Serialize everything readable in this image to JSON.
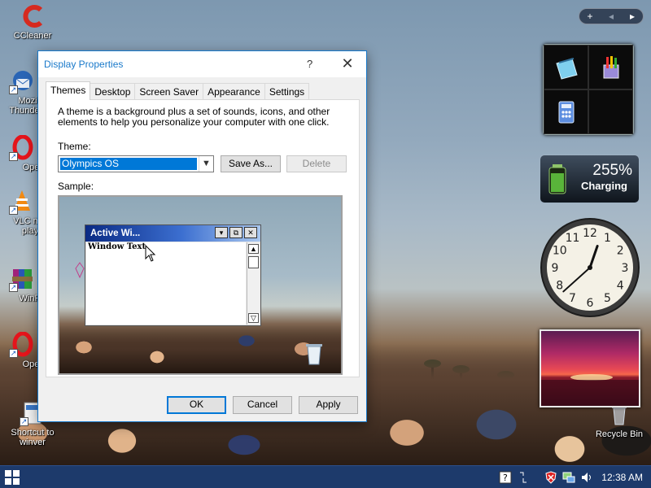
{
  "desktop": {
    "icons": [
      {
        "label": "CCleaner"
      },
      {
        "label": "Mozilla Thunderbird",
        "line1": "Mozi",
        "line2": "Thunde"
      },
      {
        "label": "Ope"
      },
      {
        "label": "VLC media player",
        "line1": "VLC m",
        "line2": "play"
      },
      {
        "label": "WinR"
      },
      {
        "label": "Ope"
      },
      {
        "label": "Shortcut to winver",
        "line1": "Shortcut to",
        "line2": "winver"
      }
    ],
    "recycle_bin": "Recycle Bin"
  },
  "gadgets": {
    "toolbar": {
      "add": "+",
      "prev": "◂",
      "next": "▸"
    },
    "battery": {
      "percent": "255%",
      "status": "Charging"
    },
    "clock": {
      "hour": 12,
      "minute": 38
    },
    "clock_numbers": [
      "1",
      "2",
      "3",
      "4",
      "5",
      "6",
      "7",
      "8",
      "9",
      "10",
      "11",
      "12"
    ]
  },
  "window": {
    "title": "Display Properties",
    "help": "?",
    "close": "✕",
    "tabs": [
      "Themes",
      "Desktop",
      "Screen Saver",
      "Appearance",
      "Settings"
    ],
    "active_tab": "Themes",
    "intro": "A theme is a background plus a set of sounds, icons, and other elements to help you personalize your computer with one click.",
    "theme_label": "Theme:",
    "theme_value": "Olympics OS",
    "save_as": "Save As...",
    "delete": "Delete",
    "sample_label": "Sample:",
    "sample": {
      "window_title": "Active Wi...",
      "window_text": "Window Text"
    },
    "ok": "OK",
    "cancel": "Cancel",
    "apply": "Apply"
  },
  "taskbar": {
    "time": "12:38 AM"
  },
  "colors": {
    "accent": "#0078d7",
    "taskbar": "#1d3a6b",
    "title_text": "#1979ca"
  }
}
